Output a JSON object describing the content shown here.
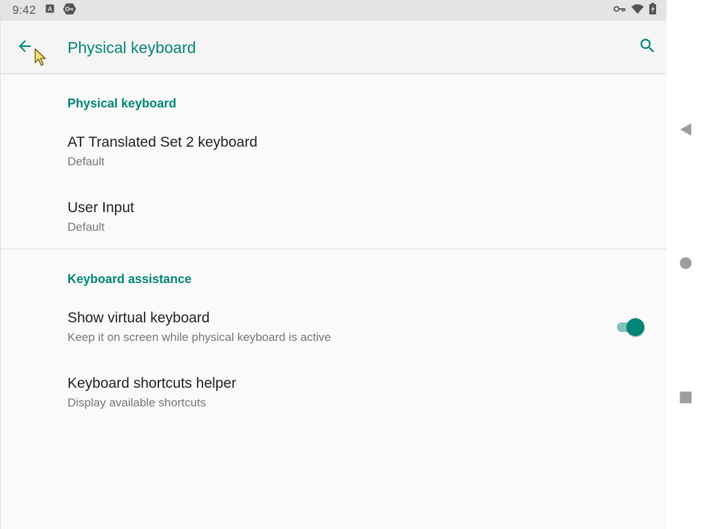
{
  "status_bar": {
    "time": "9:42",
    "left_icons": [
      "a-box-icon",
      "key-badge-icon"
    ],
    "right_icons": [
      "vpn-key-icon",
      "wifi-icon",
      "battery-icon"
    ]
  },
  "app_bar": {
    "title": "Physical keyboard",
    "back_icon": "arrow-back-icon",
    "search_icon": "search-icon"
  },
  "sections": [
    {
      "header": "Physical keyboard",
      "items": [
        {
          "title": "AT Translated Set 2 keyboard",
          "summary": "Default"
        },
        {
          "title": "User Input",
          "summary": "Default"
        }
      ]
    },
    {
      "header": "Keyboard assistance",
      "items": [
        {
          "title": "Show virtual keyboard",
          "summary": "Keep it on screen while physical keyboard is active",
          "toggle_on": true
        },
        {
          "title": "Keyboard shortcuts helper",
          "summary": "Display available shortcuts"
        }
      ]
    }
  ],
  "nav_bar": {
    "buttons": [
      "back-triangle-icon",
      "home-circle-icon",
      "recents-square-icon"
    ]
  },
  "colors": {
    "accent": "#008577",
    "toggle_track": "#80c2bb",
    "title_text": "#212121",
    "summary_text": "#757575",
    "status_bar_bg": "#e4e4e4",
    "app_bar_bg": "#f5f5f5",
    "screen_bg": "#fafafa"
  }
}
